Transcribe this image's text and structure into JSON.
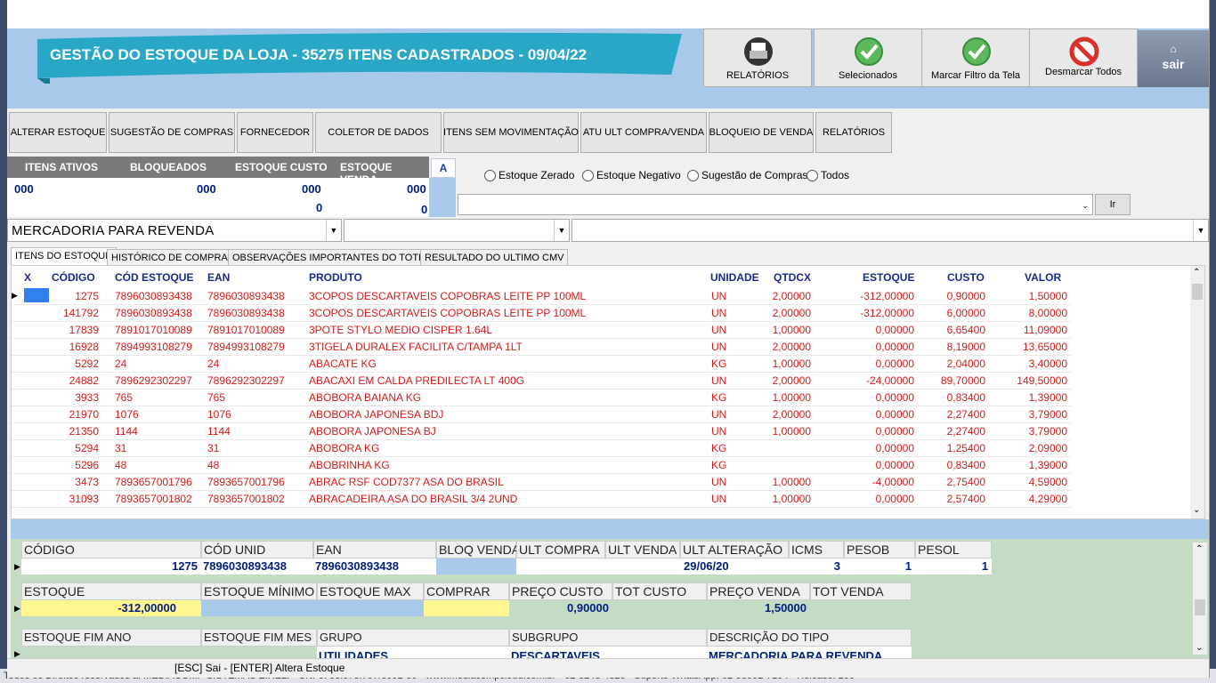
{
  "window": {
    "banner_title": "GESTÃO DO ESTOQUE DA LOJA - 35275 ITENS CADASTRADOS - 09/04/22",
    "buttons": {
      "relatorios": "RELATÓRIOS",
      "selecionados": "Selecionados",
      "marcar": "Marcar Filtro da Tela",
      "desmarcar": "Desmarcar Todos",
      "sair": "sair"
    },
    "accent": "#a9c9ea",
    "banner_color": "#29a7c7"
  },
  "toolbar": [
    "ALTERAR ESTOQUE",
    "SUGESTÃO DE COMPRAS",
    "FORNECEDOR",
    "COLETOR DE DADOS",
    "ITENS SEM MOVIMENTAÇÃO",
    "ATU ULT COMPRA/VENDA",
    "BLOQUEIO DE VENDA",
    "RELATÓRIOS"
  ],
  "stats": {
    "headers": [
      "ITENS ATIVOS",
      "BLOQUEADOS",
      "ESTOQUE CUSTO",
      "ESTOQUE VENDA"
    ],
    "ativos": "000",
    "bloqueados": "000",
    "estoque_custo": "000",
    "estoque_venda": "000",
    "custo_zero": "0",
    "venda_zero": "0",
    "a_button": "A"
  },
  "filters": {
    "radios": [
      "Estoque Zerado",
      "Estoque Negativo",
      "Sugestão de Compras",
      "Todos"
    ],
    "search_value": "",
    "go_button": "Ir",
    "category": "MERCADORIA PARA REVENDA"
  },
  "tabs": [
    "ITENS DO ESTOQUE",
    "HISTÓRICO DE COMPRAS",
    "OBSERVAÇÕES IMPORTANTES DO TOTEM",
    "RESULTADO DO ULTIMO CMV"
  ],
  "grid": {
    "columns": [
      "X",
      "CÓDIGO",
      "CÓD ESTOQUE",
      "EAN",
      "PRODUTO",
      "UNIDADE",
      "QTDCX",
      "ESTOQUE",
      "CUSTO",
      "VALOR"
    ],
    "rows": [
      [
        "1275",
        "7896030893438",
        "7896030893438",
        "3COPOS DESCARTAVEIS COPOBRAS LEITE  PP 100ML",
        "UN",
        "2,00000",
        "-312,00000",
        "0,90000",
        "1,50000"
      ],
      [
        "141792",
        "7896030893438",
        "7896030893438",
        "3COPOS DESCARTAVEIS COPOBRAS LEITE  PP 100ML",
        "UN",
        "2,00000",
        "-312,00000",
        "6,00000",
        "8,00000"
      ],
      [
        "17839",
        "7891017010089",
        "7891017010089",
        "3POTE STYLO MEDIO CISPER 1.64L",
        "UN",
        "1,00000",
        "0,00000",
        "6,65400",
        "11,09000"
      ],
      [
        "16928",
        "7894993108279",
        "7894993108279",
        "3TIGELA DURALEX FACILITA C/TAMPA 1LT",
        "UN",
        "2,00000",
        "0,00000",
        "8,19000",
        "13,65000"
      ],
      [
        "5292",
        "24",
        "24",
        "ABACATE KG",
        "KG",
        "1,00000",
        "0,00000",
        "2,04000",
        "3,40000"
      ],
      [
        "24882",
        "7896292302297",
        "7896292302297",
        "ABACAXI EM CALDA PREDILECTA LT 400G",
        "UN",
        "2,00000",
        "-24,00000",
        "89,70000",
        "149,50000"
      ],
      [
        "3933",
        "765",
        "765",
        "ABOBORA BAIANA KG",
        "KG",
        "1,00000",
        "0,00000",
        "0,83400",
        "1,39000"
      ],
      [
        "21970",
        "1076",
        "1076",
        "ABOBORA JAPONESA BDJ",
        "UN",
        "2,00000",
        "0,00000",
        "2,27400",
        "3,79000"
      ],
      [
        "21350",
        "1144",
        "1144",
        "ABOBORA JAPONESA BJ",
        "UN",
        "1,00000",
        "0,00000",
        "2,27400",
        "3,79000"
      ],
      [
        "5294",
        "31",
        "31",
        "ABOBORA KG",
        "KG",
        "",
        "0,00000",
        "1,25400",
        "2,09000"
      ],
      [
        "5296",
        "48",
        "48",
        "ABOBRINHA KG",
        "KG",
        "",
        "0,00000",
        "0,83400",
        "1,39000"
      ],
      [
        "3473",
        "7893657001796",
        "7893657001796",
        "ABRAC RSF COD7377 ASA DO BRASIL",
        "UN",
        "1,00000",
        "-4,00000",
        "2,75400",
        "4,59000"
      ],
      [
        "31093",
        "7893657001802",
        "7893657001802",
        "ABRACADEIRA ASA DO BRASIL  3/4 2UND",
        "UN",
        "1,00000",
        "0,00000",
        "2,57400",
        "4,29000"
      ]
    ]
  },
  "detail": {
    "h1": [
      "CÓDIGO",
      "CÓD UNID",
      "EAN",
      "BLOQ VENDA",
      "ULT COMPRA",
      "ULT VENDA",
      "ULT ALTERAÇÃO",
      "ICMS",
      "PESOB",
      "PESOL"
    ],
    "v1": {
      "codigo": "1275",
      "cod_unid": "7896030893438",
      "ean": "7896030893438",
      "ult_alteracao": "29/06/20",
      "icms": "3",
      "pesob": "1",
      "pesol": "1"
    },
    "h2": [
      "ESTOQUE",
      "ESTOQUE MÍNIMO",
      "ESTOQUE MAX",
      "COMPRAR",
      "PREÇO CUSTO",
      "TOT CUSTO",
      "PREÇO VENDA",
      "TOT VENDA"
    ],
    "v2": {
      "estoque": "-312,00000",
      "preco_custo": "0,90000",
      "preco_venda": "1,50000"
    },
    "h3": [
      "ESTOQUE FIM ANO",
      "ESTOQUE FIM MES",
      "GRUPO",
      "SUBGRUPO",
      "DESCRIÇÃO DO TIPO"
    ],
    "v3": {
      "grupo": "UTILIDADES",
      "subgrupo": "DESCARTAVEIS",
      "tipo": "MERCADORIA PARA REVENDA"
    }
  },
  "status": "[ESC] Sai  -  [ENTER] Altera Estoque",
  "background_footer": "Todos os Direitos reservados a: MEDIACOMP SISTEMAS EIRELI - CNPJ: 33.078.797/0001-00 - www.mediacompcloud.com.br - 62-3248-4320 - Suporte WhatsApp: 62-98592-7194 - Release: 200"
}
